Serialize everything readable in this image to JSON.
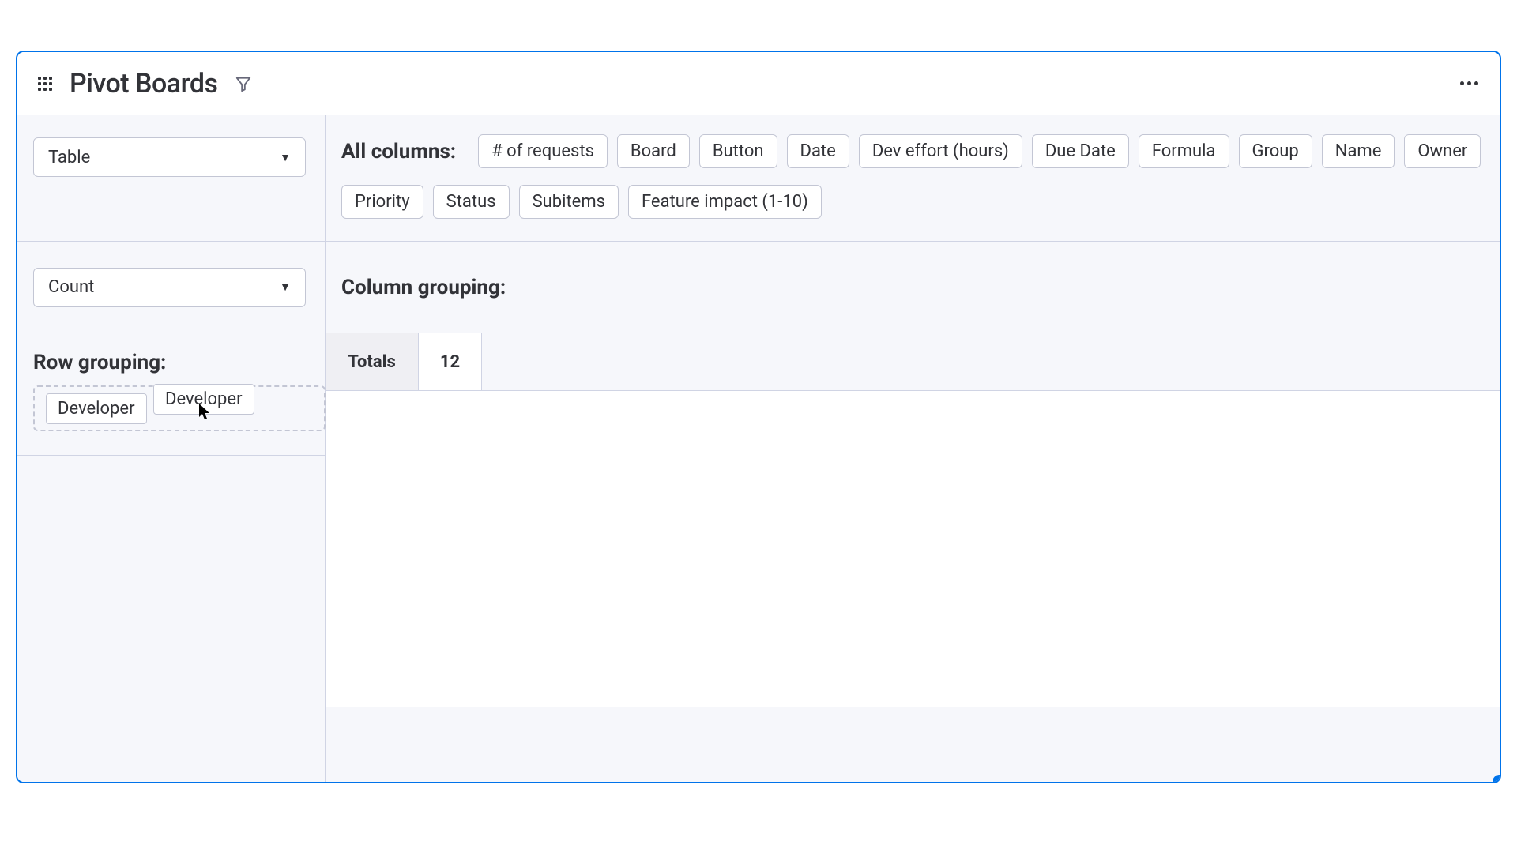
{
  "header": {
    "title": "Pivot Boards"
  },
  "left": {
    "select1": "Table",
    "select2": "Count",
    "row_grouping_label": "Row grouping:",
    "dropped_chip": "Developer",
    "dragging_chip": "Developer"
  },
  "columns_section": {
    "label": "All columns:",
    "chips": [
      "# of requests",
      "Board",
      "Button",
      "Date",
      "Dev effort (hours)",
      "Due Date",
      "Formula",
      "Group",
      "Name",
      "Owner",
      "Priority",
      "Status",
      "Subitems",
      "Feature impact (1-10)"
    ]
  },
  "column_grouping": {
    "label": "Column grouping:"
  },
  "results": {
    "totals_label": "Totals",
    "totals_value": "12"
  }
}
